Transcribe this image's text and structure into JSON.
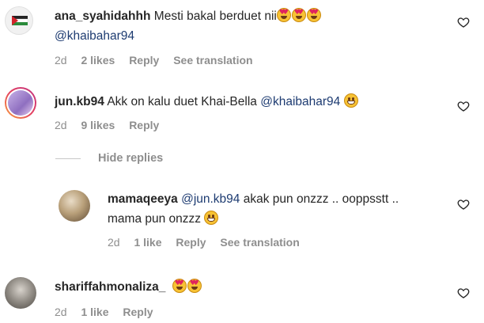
{
  "comments": [
    {
      "username": "ana_syahidahhh",
      "text": "Mesti bakal berduet nii",
      "mention": "@khaibahar94",
      "age": "2d",
      "likes": "2 likes",
      "reply": "Reply",
      "see_translation": "See translation"
    },
    {
      "username": "jun.kb94",
      "text": "Akk on kalu duet Khai-Bella",
      "mention": "@khaibahar94",
      "age": "2d",
      "likes": "9 likes",
      "reply": "Reply"
    },
    {
      "username": "mamaqeeya",
      "mention": "@jun.kb94",
      "text_line1": "akak pun onzzz .. ooppsstt ..",
      "text_line2": "mama pun onzzz",
      "age": "2d",
      "likes": "1 like",
      "reply": "Reply",
      "see_translation": "See translation"
    },
    {
      "username": "shariffahmonaliza_",
      "age": "2d",
      "likes": "1 like",
      "reply": "Reply"
    }
  ],
  "hide_replies": "Hide replies",
  "colors": {
    "text": "#262626",
    "muted": "#8e8e8e",
    "mention": "#1d3b71"
  }
}
